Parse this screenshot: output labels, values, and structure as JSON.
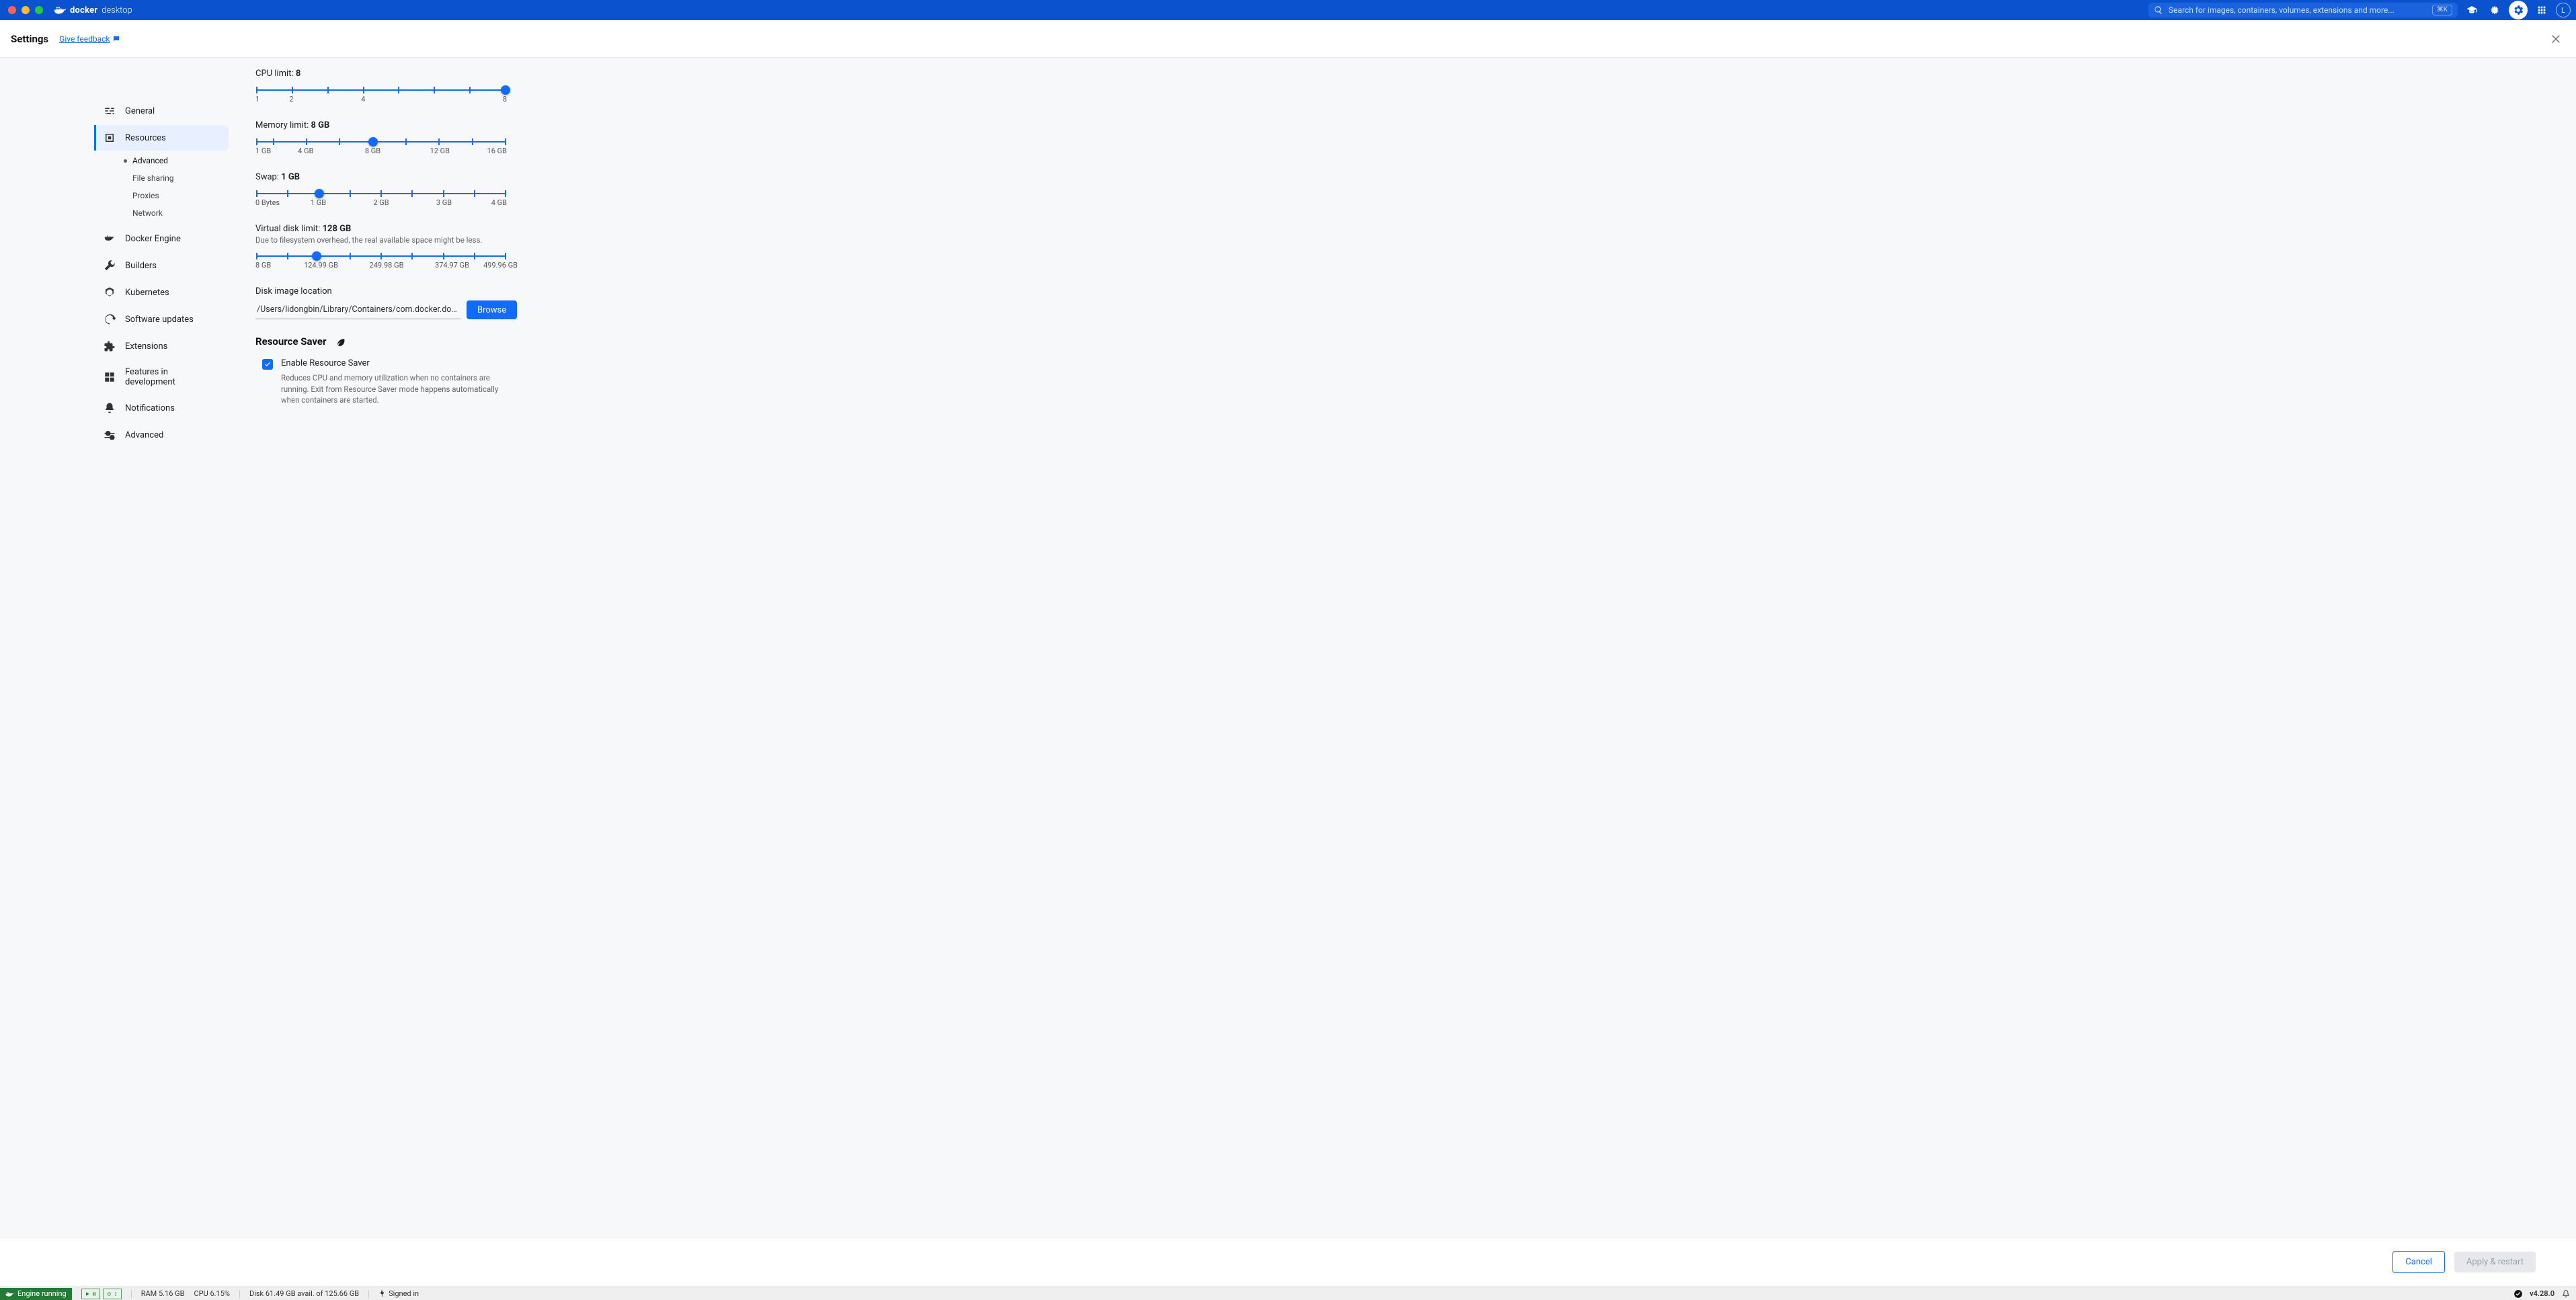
{
  "titlebar": {
    "brand_bold": "docker",
    "brand_light": "desktop",
    "search_placeholder": "Search for images, containers, volumes, extensions and more...",
    "search_shortcut": "⌘K",
    "avatar_initial": "L"
  },
  "header": {
    "title": "Settings",
    "feedback_label": "Give feedback"
  },
  "sidebar": {
    "items": [
      {
        "label": "General"
      },
      {
        "label": "Resources"
      },
      {
        "label": "Docker Engine"
      },
      {
        "label": "Builders"
      },
      {
        "label": "Kubernetes"
      },
      {
        "label": "Software updates"
      },
      {
        "label": "Extensions"
      },
      {
        "label": "Features in development"
      },
      {
        "label": "Notifications"
      },
      {
        "label": "Advanced"
      }
    ],
    "sub_items": [
      {
        "label": "Advanced"
      },
      {
        "label": "File sharing"
      },
      {
        "label": "Proxies"
      },
      {
        "label": "Network"
      }
    ]
  },
  "resources": {
    "cpu": {
      "label_prefix": "CPU limit: ",
      "value": "8",
      "ticks": [
        "1",
        "2",
        "4",
        "8"
      ],
      "tick_pcts": [
        0,
        14.29,
        28.57,
        42.86,
        57.14,
        71.43,
        85.71,
        100
      ],
      "label_pcts": [
        0,
        14.29,
        42.86,
        100
      ],
      "thumb_pct": 100
    },
    "memory": {
      "label_prefix": "Memory limit: ",
      "value": "8 GB",
      "ticks": [
        "1 GB",
        "4 GB",
        "8 GB",
        "12 GB",
        "16 GB"
      ],
      "tick_pcts": [
        0,
        6.67,
        20,
        33.33,
        46.67,
        60,
        73.33,
        86.67,
        100
      ],
      "label_pcts": [
        0,
        20,
        46.67,
        73.33,
        100
      ],
      "thumb_pct": 46.67
    },
    "swap": {
      "label_prefix": "Swap: ",
      "value": "1 GB",
      "ticks": [
        "0 Bytes",
        "1 GB",
        "2 GB",
        "3 GB",
        "4 GB"
      ],
      "tick_pcts": [
        0,
        12.5,
        25,
        37.5,
        50,
        62.5,
        75,
        87.5,
        100
      ],
      "label_pcts": [
        0,
        25,
        50,
        75,
        100
      ],
      "thumb_pct": 25
    },
    "disk": {
      "label_prefix": "Virtual disk limit: ",
      "value": "128 GB",
      "note": "Due to filesystem overhead, the real available space might be less.",
      "ticks": [
        "8 GB",
        "124.99 GB",
        "249.98 GB",
        "374.97 GB",
        "499.96 GB"
      ],
      "tick_pcts": [
        0,
        12.5,
        25,
        37.5,
        50,
        62.5,
        75,
        87.5,
        100
      ],
      "label_pcts": [
        0,
        25,
        50,
        75,
        100
      ],
      "thumb_pct": 24
    },
    "disk_location": {
      "label": "Disk image location",
      "path": "/Users/lidongbin/Library/Containers/com.docker.docker/l",
      "browse": "Browse"
    },
    "resource_saver": {
      "heading": "Resource Saver",
      "checkbox_label": "Enable Resource Saver",
      "description": "Reduces CPU and memory utilization when no containers are running. Exit from Resource Saver mode happens automatically when containers are started."
    }
  },
  "footer": {
    "cancel": "Cancel",
    "apply": "Apply & restart"
  },
  "statusbar": {
    "engine": "Engine running",
    "ram": "RAM 5.16 GB",
    "cpu": "CPU 6.15%",
    "disk": "Disk 61.49 GB avail. of 125.66 GB",
    "signed": "Signed in",
    "version": "v4.28.0"
  }
}
